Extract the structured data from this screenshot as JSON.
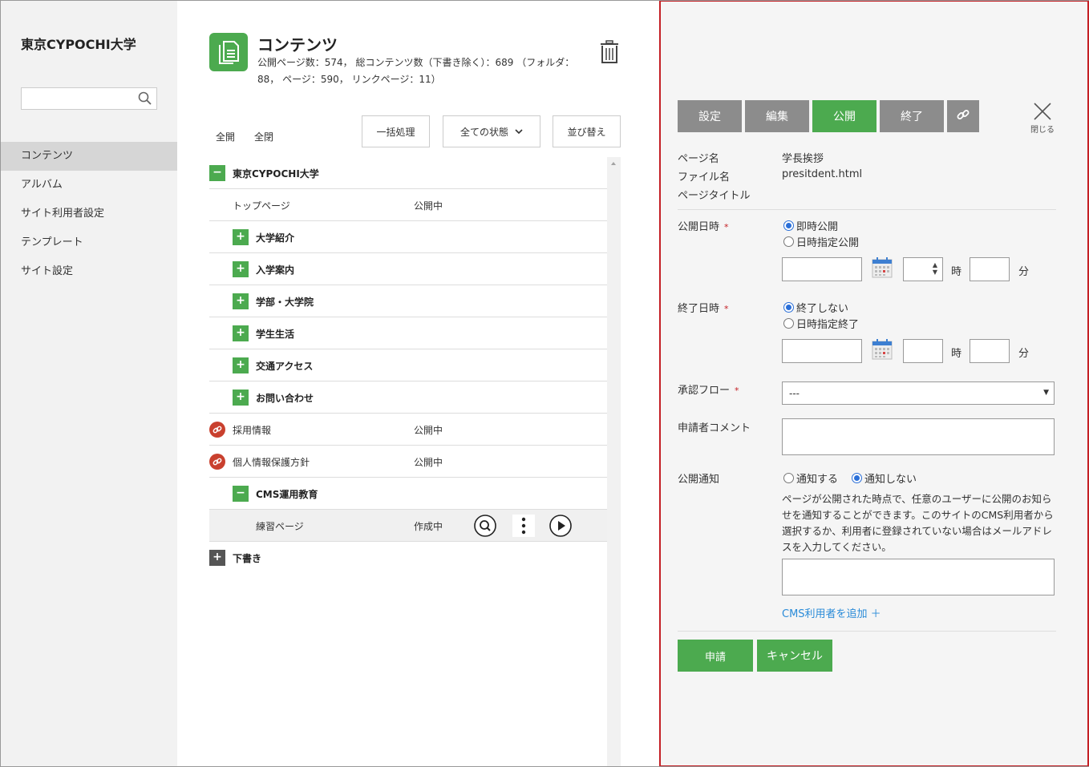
{
  "sidebar": {
    "site_title": "東京CYPOCHI大学",
    "search_placeholder": "",
    "items": [
      {
        "label": "コンテンツ"
      },
      {
        "label": "アルバム"
      },
      {
        "label": "サイト利用者設定"
      },
      {
        "label": "テンプレート"
      },
      {
        "label": "サイト設定"
      }
    ]
  },
  "main": {
    "title": "コンテンツ",
    "stats": "公開ページ数：574， 総コンテンツ数（下書き除く）：689 （フォルダ：88， ページ：590， リンクページ：11）",
    "expand_all": "全開",
    "collapse_all": "全閉",
    "bulk_button": "一括処理",
    "status_filter": "全ての状態",
    "sort_button": "並び替え",
    "tree": [
      {
        "label": "東京CYPOCHI大学",
        "status": ""
      },
      {
        "label": "トップページ",
        "status": "公開中"
      },
      {
        "label": "大学紹介",
        "status": ""
      },
      {
        "label": "入学案内",
        "status": ""
      },
      {
        "label": "学部・大学院",
        "status": ""
      },
      {
        "label": "学生生活",
        "status": ""
      },
      {
        "label": "交通アクセス",
        "status": ""
      },
      {
        "label": "お問い合わせ",
        "status": ""
      },
      {
        "label": "採用情報",
        "status": "公開中"
      },
      {
        "label": "個人情報保護方針",
        "status": "公開中"
      },
      {
        "label": "CMS運用教育",
        "status": ""
      },
      {
        "label": "練習ページ",
        "status": "作成中"
      },
      {
        "label": "下書き",
        "status": ""
      }
    ]
  },
  "panel": {
    "tabs": [
      "設定",
      "編集",
      "公開",
      "終了"
    ],
    "active_tab": "公開",
    "close_label": "閉じる",
    "page_name_label": "ページ名",
    "page_name": "学長挨拶",
    "file_name_label": "ファイル名",
    "file_name": "presitdent.html",
    "page_title_label": "ページタイトル",
    "page_title": "",
    "publish_date_label": "公開日時",
    "required_mark": "*",
    "publish_now": "即時公開",
    "publish_scheduled": "日時指定公開",
    "hour_unit": "時",
    "minute_unit": "分",
    "end_date_label": "終了日時",
    "no_end": "終了しない",
    "scheduled_end": "日時指定終了",
    "approval_label": "承認フロー",
    "approval_value": "---",
    "comment_label": "申請者コメント",
    "notify_label": "公開通知",
    "notify_yes": "通知する",
    "notify_no": "通知しない",
    "notify_help": "ページが公開された時点で、任意のユーザーに公開のお知らせを通知することができます。このサイトのCMS利用者から選択するか、利用者に登録されていない場合はメールアドレスを入力してください。",
    "add_user": "CMS利用者を追加 ＋",
    "apply_button": "申請",
    "cancel_button": "キャンセル"
  },
  "colors": {
    "accent_green": "#4caa4f",
    "tab_gray": "#8c8c8c",
    "panel_border": "#c42025",
    "link_blue": "#2a8bd8"
  }
}
